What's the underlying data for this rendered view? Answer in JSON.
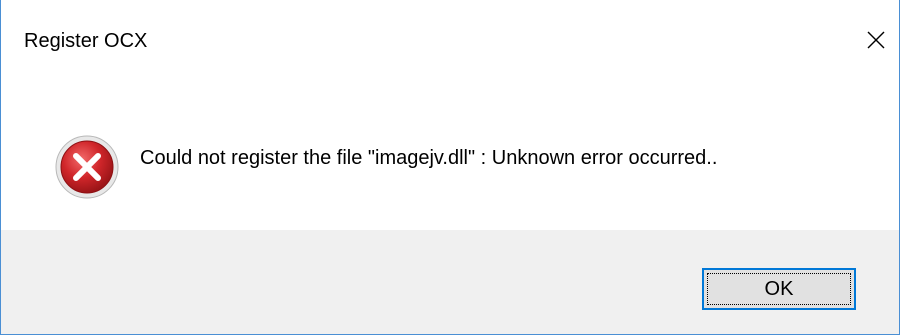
{
  "window": {
    "title": "Register OCX",
    "close_icon": "close-icon"
  },
  "message": {
    "icon": "error-icon",
    "text": "Could not register the file \"imagejv.dll\" : Unknown error occurred.."
  },
  "buttons": {
    "ok_label": "OK"
  },
  "colors": {
    "window_border": "#4a8fd4",
    "footer_background": "#f0f0f0",
    "button_focus_border": "#0078d7",
    "button_background": "#e1e1e1",
    "error_red": "#d0262a"
  }
}
